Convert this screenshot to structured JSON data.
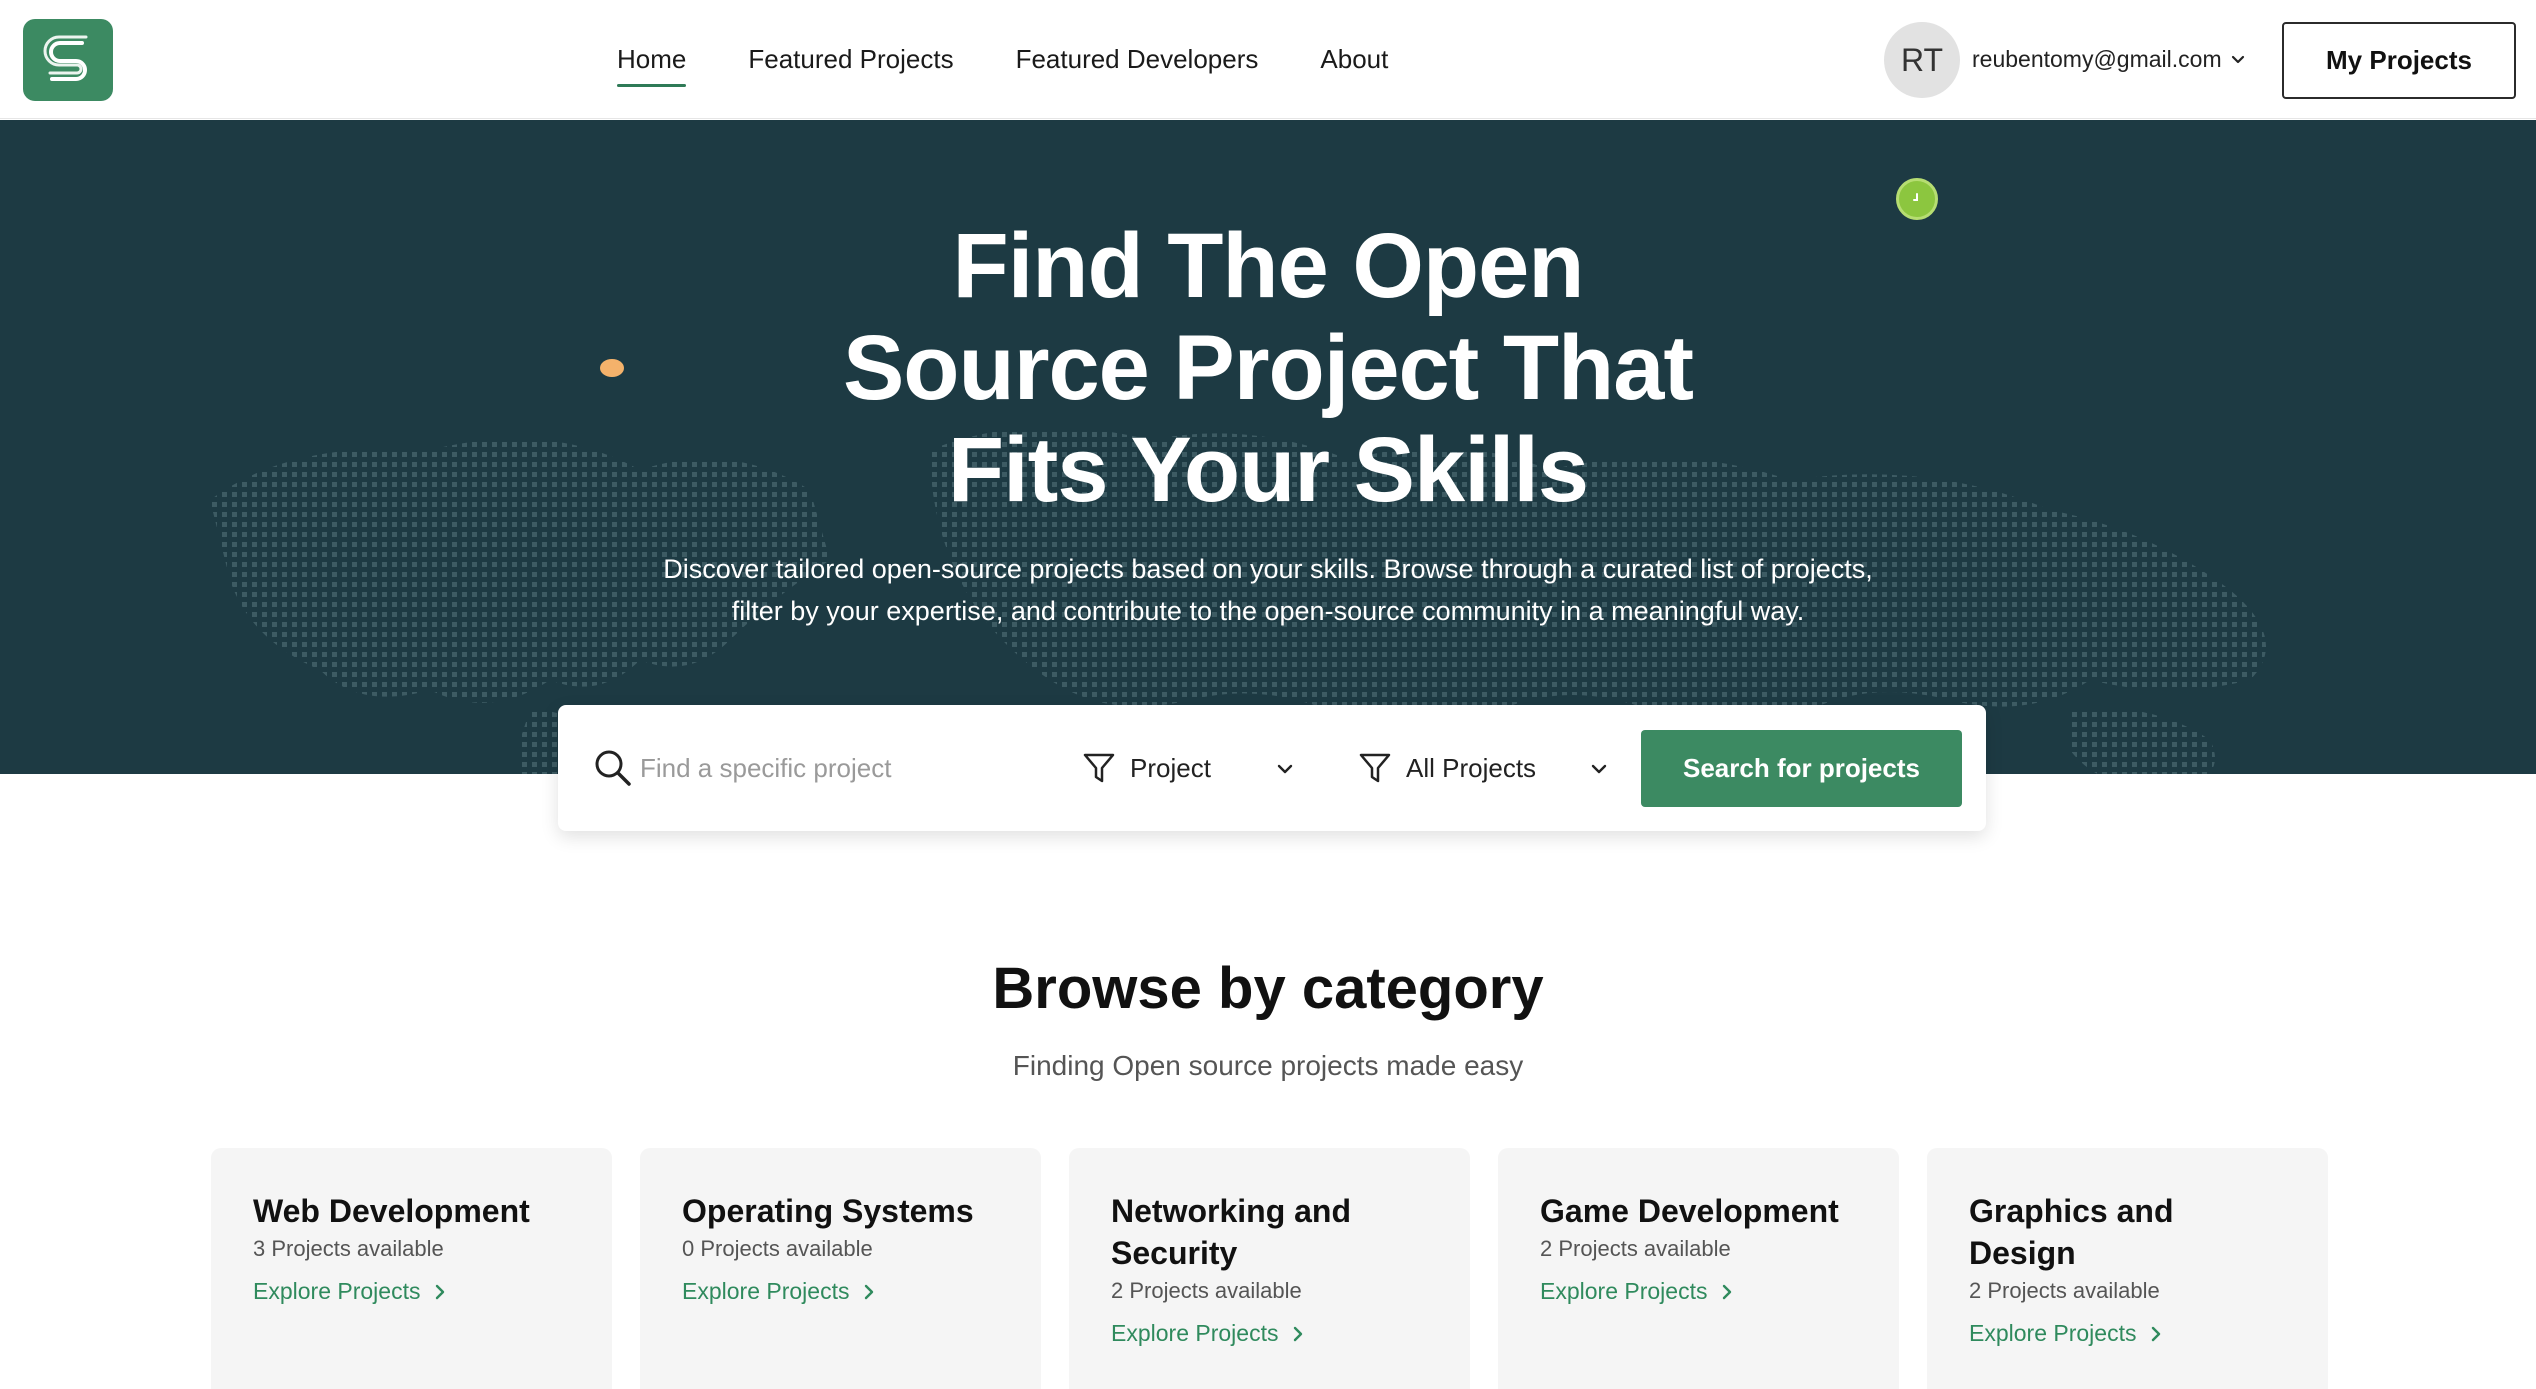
{
  "nav": {
    "links": [
      {
        "label": "Home",
        "active": true
      },
      {
        "label": "Featured Projects",
        "active": false
      },
      {
        "label": "Featured Developers",
        "active": false
      },
      {
        "label": "About",
        "active": false
      }
    ],
    "avatar_initials": "RT",
    "user_email": "reubentomy@gmail.com",
    "my_projects_label": "My Projects"
  },
  "hero": {
    "title_lines": [
      "Find The Open",
      "Source Project That",
      "Fits Your Skills"
    ],
    "subtitle_lines": [
      "Discover tailored open-source projects based on your skills. Browse through a curated list of projects,",
      "filter by your expertise, and contribute to the open-source community in a meaningful way."
    ]
  },
  "search": {
    "placeholder": "Find a specific project",
    "filter_type": "Project",
    "filter_scope": "All Projects",
    "button_label": "Search for projects"
  },
  "category": {
    "title": "Browse by category",
    "subtitle": "Finding Open source projects made easy",
    "cards": [
      {
        "title": "Web Development",
        "count": "3 Projects available",
        "link": "Explore Projects"
      },
      {
        "title": "Operating Systems",
        "count": "0 Projects available",
        "link": "Explore Projects"
      },
      {
        "title": "Networking and Security",
        "count": "2 Projects available",
        "link": "Explore Projects"
      },
      {
        "title": "Game Development",
        "count": "2 Projects available",
        "link": "Explore Projects"
      },
      {
        "title": "Graphics and Design",
        "count": "2 Projects available",
        "link": "Explore Projects"
      }
    ]
  },
  "colors": {
    "brand_green": "#3c8a62",
    "hero_bg": "#1d3a43",
    "link_green": "#2f8a5d"
  },
  "icons": [
    "logo-s-icon",
    "chevron-down-icon",
    "search-icon",
    "filter-icon",
    "chevron-right-icon"
  ]
}
